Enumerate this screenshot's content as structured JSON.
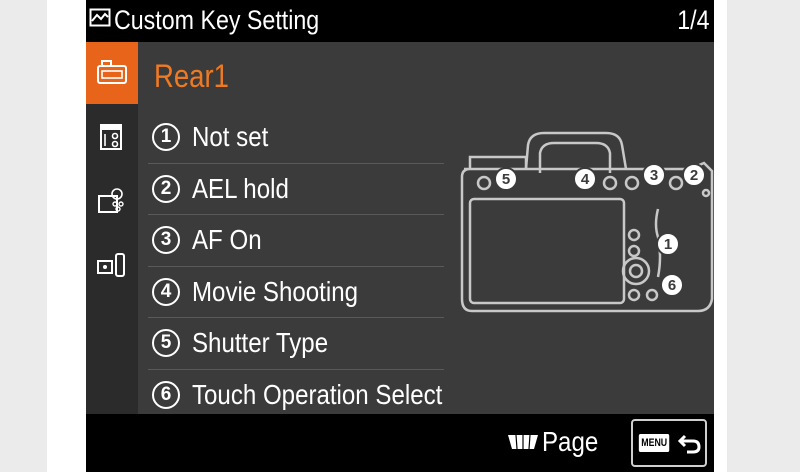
{
  "header": {
    "title": "Custom Key Setting",
    "page_indicator": "1/4"
  },
  "sidebar": {
    "tabs": [
      {
        "name": "camera-tab",
        "active": true
      },
      {
        "name": "camera-dial-tab",
        "active": false
      },
      {
        "name": "camera-custom-tab",
        "active": false
      },
      {
        "name": "playback-tab",
        "active": false
      }
    ]
  },
  "main": {
    "heading": "Rear1",
    "items": [
      {
        "number": "1",
        "label": "Not set"
      },
      {
        "number": "2",
        "label": "AEL hold"
      },
      {
        "number": "3",
        "label": "AF On"
      },
      {
        "number": "4",
        "label": "Movie Shooting"
      },
      {
        "number": "5",
        "label": "Shutter Type"
      },
      {
        "number": "6",
        "label": "Touch Operation Select"
      }
    ]
  },
  "camera_diagram": {
    "callouts": [
      "5",
      "4",
      "3",
      "2",
      "1",
      "6"
    ]
  },
  "footer": {
    "page_label": "Page",
    "menu_label": "MENU"
  },
  "colors": {
    "accent": "#e8641a",
    "heading": "#f07a22",
    "background": "#3b3b3b",
    "bar": "#000000"
  }
}
